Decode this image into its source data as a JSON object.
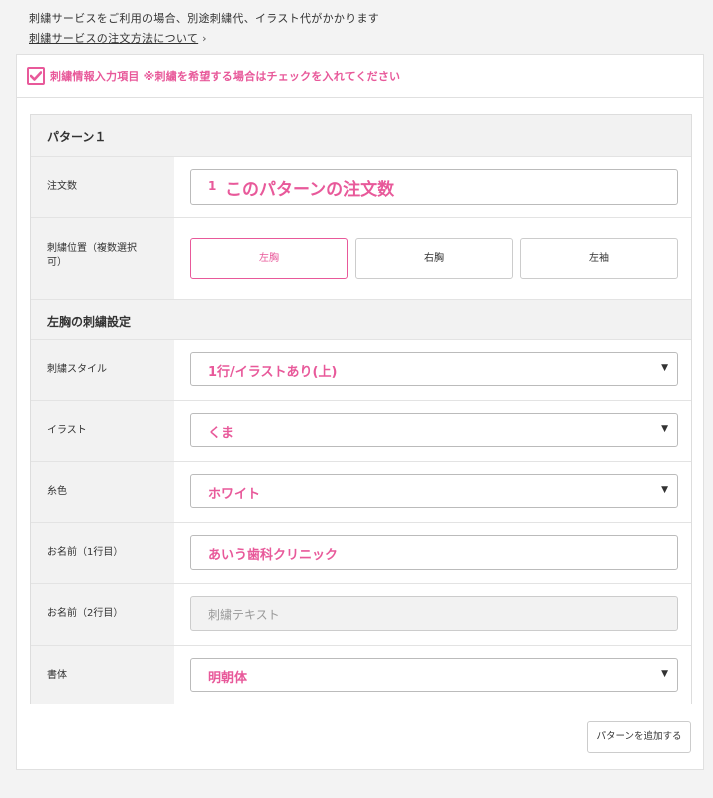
{
  "notice": {
    "text": "刺繍サービスをご利用の場合、別途刺繍代、イラスト代がかかります",
    "link": "刺繍サービスの注文方法について"
  },
  "embroidery": {
    "checked": true,
    "label": "刺繍情報入力項目 ※刺繍を希望する場合はチェックを入れてください"
  },
  "pattern": {
    "title": "パターン１",
    "quantity": {
      "label": "注文数",
      "value": "1",
      "placeholder": "このパターンの注文数"
    },
    "position": {
      "label": "刺繍位置（複数選択可）",
      "label_line1": "刺繍位置（複数選択",
      "label_line2": "可）",
      "options": [
        "左胸",
        "右胸",
        "左袖"
      ],
      "selected": "左胸"
    },
    "settings_title": "左胸の刺繍設定",
    "style": {
      "label": "刺繍スタイル",
      "value": "1行/イラストあり(上)"
    },
    "illustration": {
      "label": "イラスト",
      "value": "くま"
    },
    "thread_color": {
      "label": "糸色",
      "value": "ホワイト"
    },
    "name1": {
      "label": "お名前（1行目）",
      "value": "あいう歯科クリニック"
    },
    "name2": {
      "label": "お名前（2行目）",
      "placeholder": "刺繍テキスト"
    },
    "font": {
      "label": "書体",
      "value": "明朝体"
    }
  },
  "add_pattern_label": "パターンを追加する",
  "colors": {
    "accent": "#e8599a",
    "label_bg": "#f2f2f2",
    "border": "#e0e0e0"
  }
}
